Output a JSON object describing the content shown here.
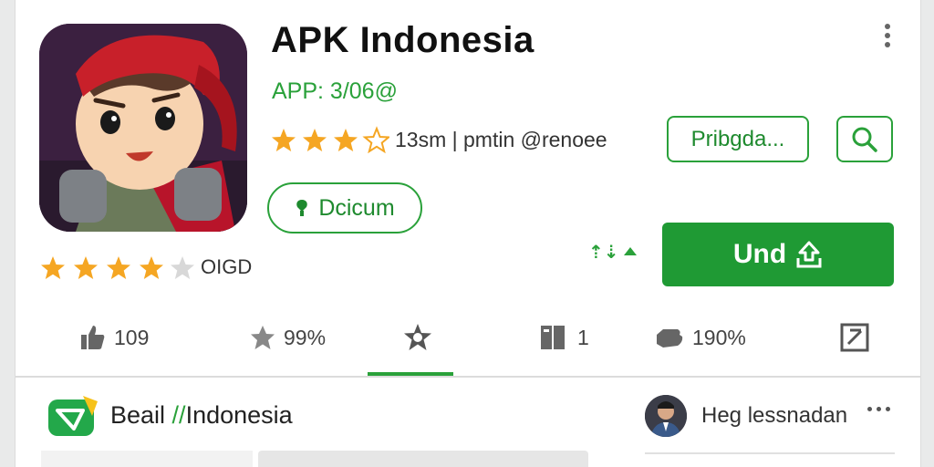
{
  "app": {
    "title": "APK Indonesia",
    "subtitle": "APP: 3/06@",
    "rating_text": "13sm | pmtin @renoee",
    "secondary_rating_text": "OIGD",
    "top_stars": 3.5,
    "left_stars": 4
  },
  "actions": {
    "outline_button": "Pribgda...",
    "pill_button": "Dcicum",
    "install_button": "Und",
    "bars_mark": "⇡⇣"
  },
  "tabs": [
    {
      "label": "109",
      "icon": "thumbs-up-icon"
    },
    {
      "label": "99%",
      "icon": "star-icon"
    },
    {
      "label": "",
      "icon": "star-badge-icon",
      "active": true
    },
    {
      "label": "1",
      "icon": "book-icon"
    },
    {
      "label": "190%",
      "icon": "hand-icon"
    },
    {
      "label": "",
      "icon": "edit-icon"
    }
  ],
  "developer": {
    "name_prefix": "Beail ",
    "name_accent": "//",
    "name_suffix": "Indonesia"
  },
  "user": {
    "name": "Heg lessnadan"
  },
  "colors": {
    "accent": "#2aa13a",
    "install": "#1f9a34",
    "star": "#f5a623"
  }
}
